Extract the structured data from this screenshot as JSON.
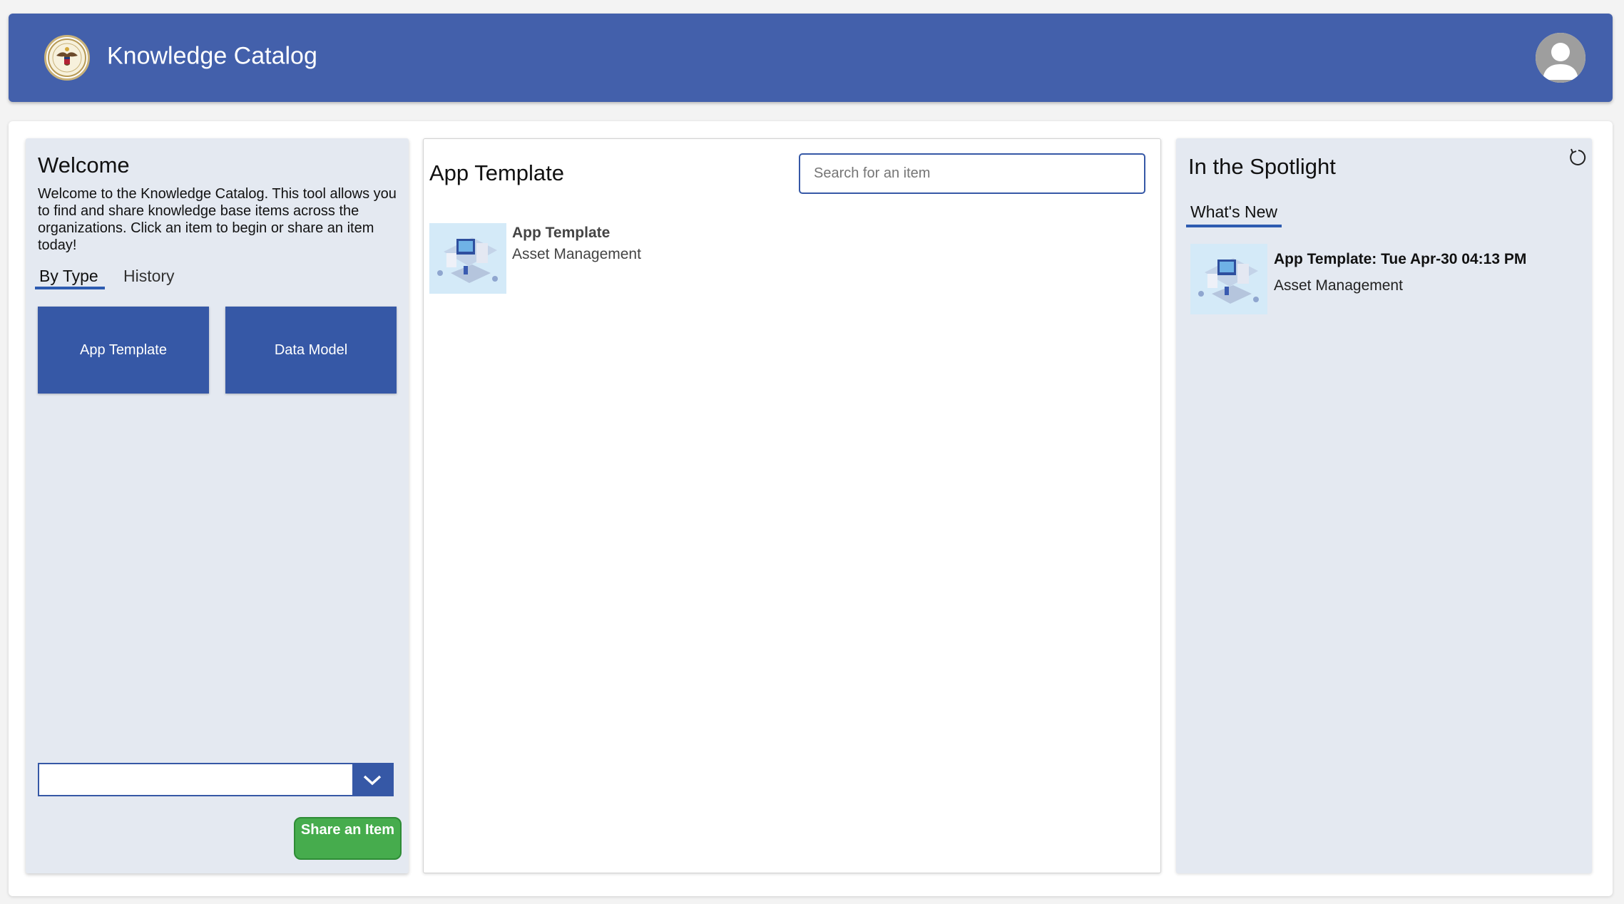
{
  "header": {
    "title": "Knowledge Catalog",
    "seal_icon": "seal-icon",
    "avatar_icon": "user-avatar-icon",
    "color": "#4360ab"
  },
  "welcome": {
    "title": "Welcome",
    "text": "Welcome to the Knowledge Catalog. This tool allows you to find and share knowledge base items across the organizations. Click an item to begin or share an item today!",
    "tabs": [
      {
        "label": "By Type",
        "active": true
      },
      {
        "label": "History",
        "active": false
      }
    ],
    "type_buttons": [
      "App Template",
      "Data Model"
    ],
    "select_value": "",
    "share_label": "Share an Item",
    "button_color": "#3658a6",
    "share_color": "#46ac4d"
  },
  "catalog": {
    "title": "App Template",
    "search_placeholder": "Search for an item",
    "items": [
      {
        "title": "App Template",
        "subtitle": "Asset Management"
      }
    ]
  },
  "spotlight": {
    "title": "In the Spotlight",
    "tab": "What's New",
    "items": [
      {
        "title": "App Template: Tue Apr-30 04:13 PM",
        "subtitle": "Asset Management"
      }
    ]
  }
}
